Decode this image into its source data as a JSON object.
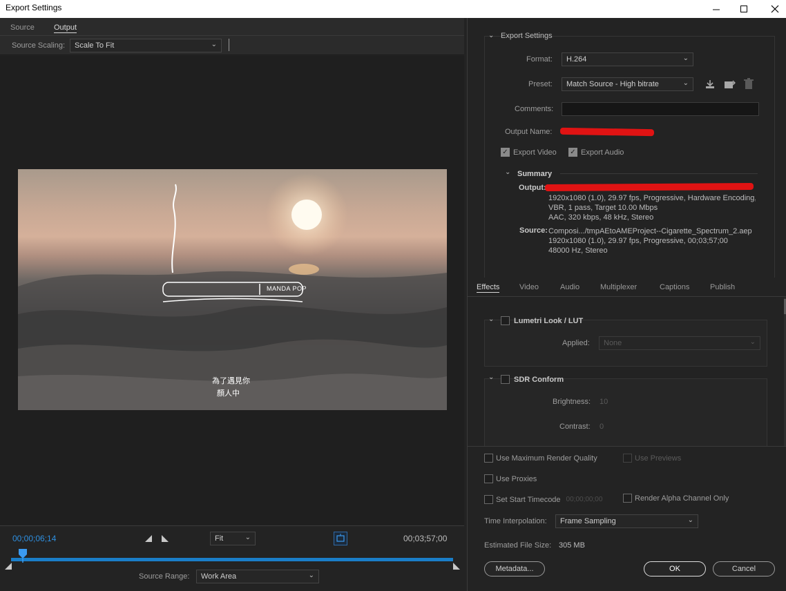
{
  "window": {
    "title": "Export Settings",
    "controls": [
      "minimize-icon",
      "maximize-icon",
      "close-icon"
    ]
  },
  "left_tabs": {
    "source": "Source",
    "output": "Output"
  },
  "source_scaling": {
    "label": "Source Scaling:",
    "value": "Scale To Fit"
  },
  "video_overlay": {
    "badge_text": "MANDA POP",
    "line1": "為了遇見你",
    "line2": "顏人中"
  },
  "timeline": {
    "current_time": "00;00;06;14",
    "zoom": "Fit",
    "end_time": "00;03;57;00",
    "playhead_fraction": 0.027,
    "source_range_label": "Source Range:",
    "source_range_value": "Work Area"
  },
  "export_settings": {
    "header": "Export Settings",
    "format_label": "Format:",
    "format_value": "H.264",
    "preset_label": "Preset:",
    "preset_value": "Match Source - High bitrate",
    "comments_label": "Comments:",
    "comments_value": "",
    "output_name_label": "Output Name:",
    "export_video": "Export Video",
    "export_audio": "Export Audio"
  },
  "summary": {
    "header": "Summary",
    "output_label": "Output:",
    "output_lines": [
      "1920x1080 (1.0), 29.97 fps, Progressive, Hardware Encoding,...",
      "VBR, 1 pass, Target 10.00 Mbps",
      "AAC, 320 kbps, 48 kHz, Stereo"
    ],
    "source_label": "Source:",
    "source_lines": [
      "Composi.../tmpAEtoAMEProject--Cigarette_Spectrum_2.aep",
      "1920x1080 (1.0), 29.97 fps, Progressive, 00;03;57;00",
      "48000 Hz, Stereo"
    ]
  },
  "right_tabs": [
    "Effects",
    "Video",
    "Audio",
    "Multiplexer",
    "Captions",
    "Publish"
  ],
  "effects": {
    "lumetri": {
      "title": "Lumetri Look / LUT",
      "applied_label": "Applied:",
      "applied_value": "None"
    },
    "sdr": {
      "title": "SDR Conform",
      "brightness_label": "Brightness:",
      "brightness_value": "10",
      "contrast_label": "Contrast:",
      "contrast_value": "0"
    }
  },
  "options": {
    "max_render": "Use Maximum Render Quality",
    "use_previews": "Use Previews",
    "use_proxies": "Use Proxies",
    "start_timecode": "Set Start Timecode",
    "start_timecode_value": "00;00;00;00",
    "alpha_only": "Render Alpha Channel Only",
    "time_interp_label": "Time Interpolation:",
    "time_interp_value": "Frame Sampling",
    "file_size_label": "Estimated File Size:",
    "file_size_value": "305 MB"
  },
  "buttons": {
    "metadata": "Metadata...",
    "ok": "OK",
    "cancel": "Cancel"
  },
  "colors": {
    "timecode_blue": "#2e8fe0",
    "redaction": "#e01313",
    "timeline_bar": "#1a7ec8"
  }
}
